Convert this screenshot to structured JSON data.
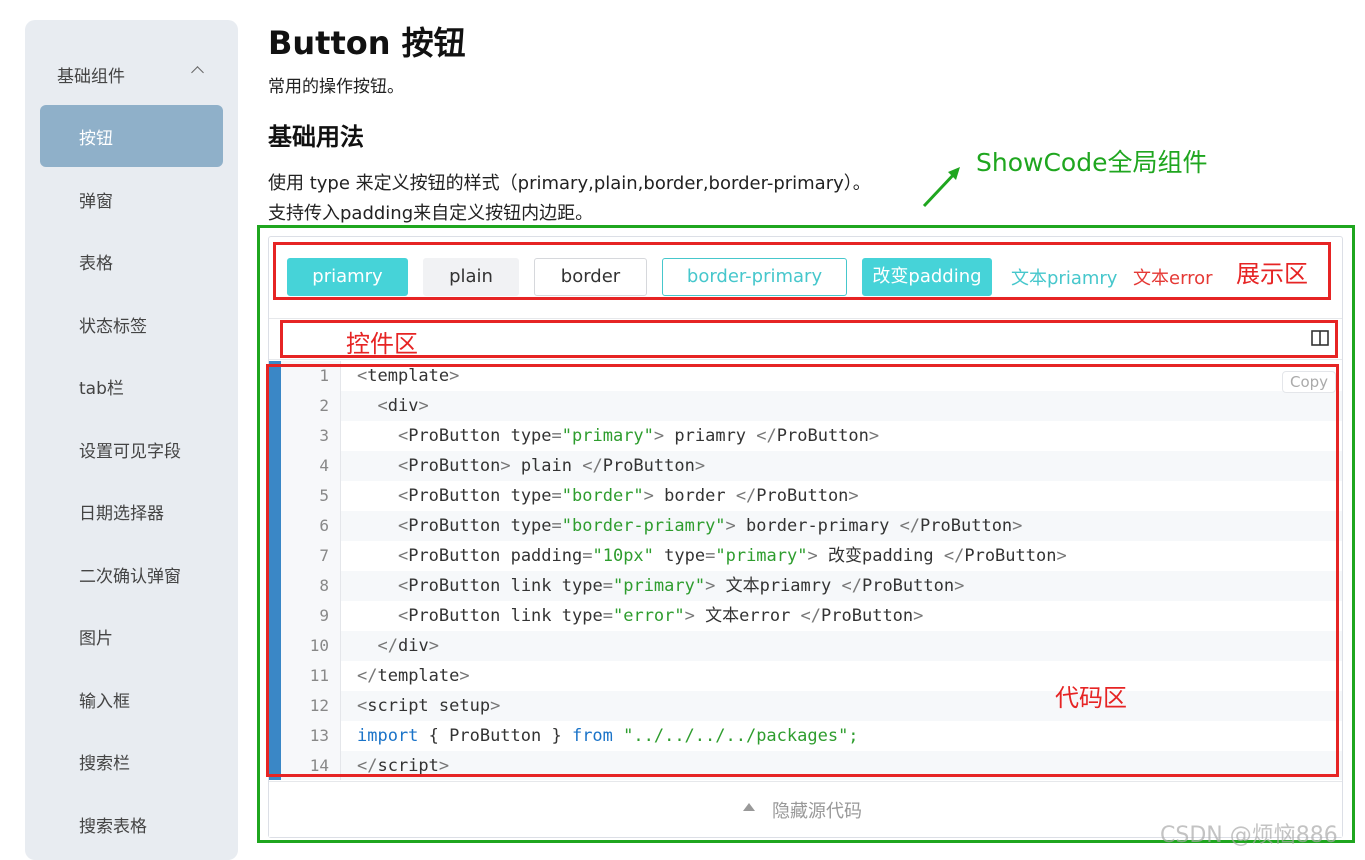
{
  "sidebar": {
    "group_title": "基础组件",
    "items": [
      {
        "label": "按钮",
        "active": true
      },
      {
        "label": "弹窗"
      },
      {
        "label": "表格"
      },
      {
        "label": "状态标签"
      },
      {
        "label": "tab栏"
      },
      {
        "label": "设置可见字段"
      },
      {
        "label": "日期选择器"
      },
      {
        "label": "二次确认弹窗"
      },
      {
        "label": "图片"
      },
      {
        "label": "输入框"
      },
      {
        "label": "搜索栏"
      },
      {
        "label": "搜索表格"
      }
    ]
  },
  "page": {
    "title": "Button 按钮",
    "desc": "常用的操作按钮。",
    "section_title": "基础用法",
    "section_desc1": "使用 type 来定义按钮的样式（primary,plain,border,border-primary）。",
    "section_desc2": "支持传入padding来自定义按钮内边距。"
  },
  "annotations": {
    "global_component": "ShowCode全局组件",
    "display_area": "展示区",
    "control_area": "控件区",
    "code_area": "代码区"
  },
  "demo": {
    "buttons": {
      "primary": "priamry",
      "plain": "plain",
      "border": "border",
      "border_primary": "border-primary",
      "padding": "改变padding",
      "link_primary": "文本priamry",
      "link_error": "文本error"
    },
    "copy_label": "Copy",
    "toggle_label": "隐藏源代码",
    "code_lines": [
      {
        "n": "1"
      },
      {
        "n": "2"
      },
      {
        "n": "3"
      },
      {
        "n": "4"
      },
      {
        "n": "5"
      },
      {
        "n": "6"
      },
      {
        "n": "7"
      },
      {
        "n": "8"
      },
      {
        "n": "9"
      },
      {
        "n": "10"
      },
      {
        "n": "11"
      },
      {
        "n": "12"
      },
      {
        "n": "13"
      },
      {
        "n": "14"
      }
    ],
    "code": {
      "l1_tag": "template",
      "l2_tag": "div",
      "pb": "ProButton",
      "type": "type",
      "padding": "padding",
      "link": "link",
      "v_primary": "\"primary\"",
      "v_border": "\"border\"",
      "v_border_priamry": "\"border-priamry\"",
      "v_10px": "\"10px\"",
      "v_error": "\"error\"",
      "t_priamry": " priamry ",
      "t_plain": " plain ",
      "t_border": " border ",
      "t_border_primary": " border-primary ",
      "t_padding": " 改变padding ",
      "t_link_priamry": " 文本priamry ",
      "t_link_error": " 文本error ",
      "script_tag": "script",
      "setup": "setup",
      "import_kw": "import",
      "import_name": " { ProButton } ",
      "from_kw": "from",
      "import_path": " \"../../../../packages\";"
    }
  },
  "colors": {
    "accent": "#46d3d8",
    "sidebar_active": "#8fb0c9",
    "annotation_green": "#1fa61f",
    "annotation_red": "#e62424"
  },
  "watermark": "CSDN @烦恼886"
}
